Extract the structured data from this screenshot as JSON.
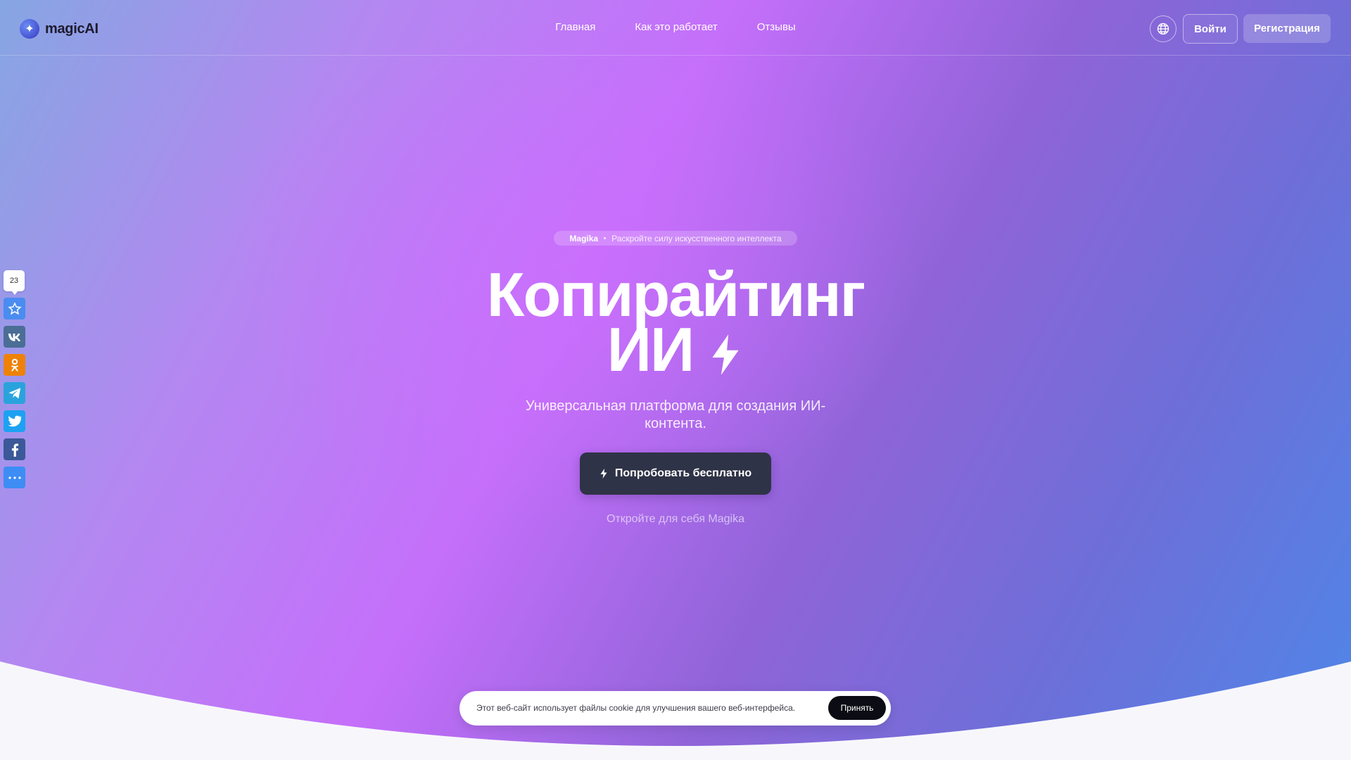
{
  "header": {
    "brand": "magicAI",
    "nav": [
      {
        "label": "Главная"
      },
      {
        "label": "Как это работает"
      },
      {
        "label": "Отзывы"
      }
    ],
    "login_label": "Войти",
    "signup_label": "Регистрация"
  },
  "hero": {
    "badge_brand": "Magika",
    "badge_text": "Раскройте силу искусственного интеллекта",
    "headline_line1": "Копирайтинг",
    "headline_line2": "ИИ",
    "subtitle": "Универсальная платформа для создания ИИ-контента.",
    "cta_label": "Попробовать бесплатно",
    "discover_text": "Откройте для себя Magika"
  },
  "share": {
    "count": "23",
    "buttons": [
      {
        "icon": "star-icon",
        "color": "#4a8cf0"
      },
      {
        "icon": "vk-icon",
        "color": "#4a6e96"
      },
      {
        "icon": "odnoklassniki-icon",
        "color": "#ee8208"
      },
      {
        "icon": "telegram-icon",
        "color": "#2aa3dc"
      },
      {
        "icon": "twitter-icon",
        "color": "#1da1f2"
      },
      {
        "icon": "facebook-icon",
        "color": "#3b5998"
      },
      {
        "icon": "more-icon",
        "color": "#3d8df5"
      }
    ]
  },
  "cookie": {
    "text": "Этот веб-сайт использует файлы cookie для улучшения вашего веб-интерфейса.",
    "accept_label": "Принять"
  },
  "colors": {
    "cta_bg": "#2f3347",
    "gradient_purple": "#c56ffb",
    "gradient_blue": "#4f86e8"
  }
}
